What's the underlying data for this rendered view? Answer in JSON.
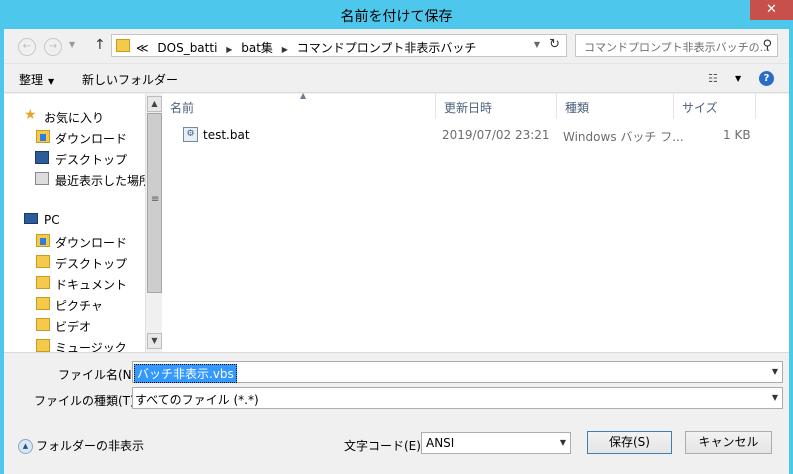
{
  "window": {
    "title": "名前を付けて保存",
    "close_glyph": "✕"
  },
  "nav": {
    "back_glyph": "←",
    "forward_glyph": "→",
    "up_glyph": "↑",
    "breadcrumbs": [
      "≪",
      "DOS_batti",
      "bat集",
      "コマンドプロンプト非表示バッチ"
    ],
    "refresh_glyph": "↻",
    "search_placeholder": "コマンドプロンプト非表示バッチの...",
    "search_icon": "search-icon"
  },
  "toolbar": {
    "organize": "整理",
    "new_folder": "新しいフォルダー",
    "help": "?"
  },
  "sidebar": {
    "items": [
      {
        "label": "お気に入り",
        "icon": "star-icon"
      },
      {
        "label": "ダウンロード",
        "icon": "downloads-folder-icon"
      },
      {
        "label": "デスクトップ",
        "icon": "desktop-icon"
      },
      {
        "label": "最近表示した場所",
        "icon": "recent-places-icon"
      },
      {
        "label": "PC",
        "icon": "computer-icon"
      },
      {
        "label": "ダウンロード",
        "icon": "downloads-folder-icon"
      },
      {
        "label": "デスクトップ",
        "icon": "desktop-folder-icon"
      },
      {
        "label": "ドキュメント",
        "icon": "documents-folder-icon"
      },
      {
        "label": "ピクチャ",
        "icon": "pictures-folder-icon"
      },
      {
        "label": "ビデオ",
        "icon": "videos-folder-icon"
      },
      {
        "label": "ミュージック",
        "icon": "music-folder-icon"
      }
    ]
  },
  "files": {
    "columns": [
      "名前",
      "更新日時",
      "種類",
      "サイズ"
    ],
    "rows": [
      {
        "name": "test.bat",
        "modified": "2019/07/02 23:21",
        "type": "Windows バッチ フ...",
        "size": "1 KB"
      }
    ]
  },
  "form": {
    "filename_label": "ファイル名(N):",
    "filename_value": "バッチ非表示.vbs",
    "filetype_label": "ファイルの種類(T):",
    "filetype_value": "すべてのファイル (*.*)",
    "encoding_label": "文字コード(E):",
    "encoding_value": "ANSI",
    "save_button": "保存(S)",
    "cancel_button": "キャンセル",
    "hide_folders": "フォルダーの非表示"
  }
}
